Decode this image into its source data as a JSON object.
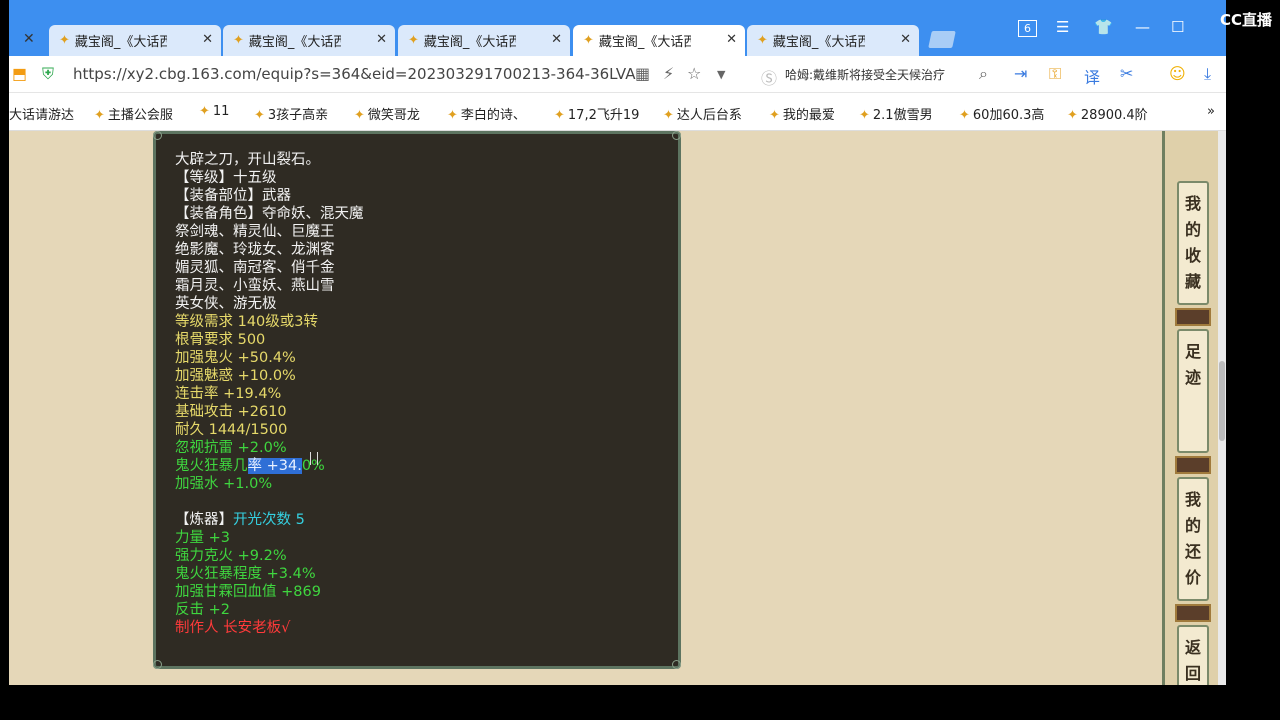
{
  "tabs": [
    {
      "label": "藏宝阁_《大话西游",
      "active": false
    },
    {
      "label": "藏宝阁_《大话西游",
      "active": false
    },
    {
      "label": "藏宝阁_《大话西游",
      "active": false
    },
    {
      "label": "藏宝阁_《大话西游",
      "active": true
    },
    {
      "label": "藏宝阁_《大话西游",
      "active": false
    }
  ],
  "window": {
    "tab_count": "6"
  },
  "address": {
    "url": "https://xy2.cbg.163.com/equip?s=364&eid=202303291700213-364-36LVA",
    "search_text": "哈姆:戴维斯将接受全天候治疗"
  },
  "bookmarks": [
    "大话请游达",
    "主播公会服",
    "11",
    "3孩子高亲",
    "微笑哥龙",
    "李白的诗、",
    "17,2飞升19",
    "达人后台系",
    "我的最爱",
    "2.1傲雪男",
    "60加60.3高",
    "28900.4阶"
  ],
  "item": {
    "lines": [
      {
        "text": "大辟之刀，开山裂石。",
        "color": "white"
      },
      {
        "text": "【等级】十五级",
        "color": "white"
      },
      {
        "text": "【装备部位】武器",
        "color": "white"
      },
      {
        "text": "【装备角色】夺命妖、混天魔",
        "color": "white"
      },
      {
        "text": "祭剑魂、精灵仙、巨魔王",
        "color": "white"
      },
      {
        "text": "绝影魔、玲珑女、龙渊客",
        "color": "white"
      },
      {
        "text": "媚灵狐、南冠客、俏千金",
        "color": "white"
      },
      {
        "text": "霜月灵、小蛮妖、燕山雪",
        "color": "white"
      },
      {
        "text": "英女侠、游无极",
        "color": "white"
      },
      {
        "text": "等级需求 140级或3转",
        "color": "yellow"
      },
      {
        "text": "根骨要求 500",
        "color": "yellow"
      },
      {
        "text": "加强鬼火 +50.4%",
        "color": "yellow"
      },
      {
        "text": "加强魅惑 +10.0%",
        "color": "yellow"
      },
      {
        "text": "连击率 +19.4%",
        "color": "yellow"
      },
      {
        "text": "基础攻击 +2610",
        "color": "yellow"
      },
      {
        "text": "耐久 1444/1500",
        "color": "yellow"
      },
      {
        "text": "忽视抗雷 +2.0%",
        "color": "green"
      },
      {
        "text": "鬼火狂暴几率 +34.0%",
        "color": "green",
        "selected_part": "率 +34."
      },
      {
        "text": "加强水 +1.0%",
        "color": "green"
      },
      {
        "text": "",
        "color": "white"
      },
      {
        "text": "【炼器】开光次数 5",
        "color": "mixed"
      },
      {
        "text": "力量 +3",
        "color": "green"
      },
      {
        "text": "强力克火 +9.2%",
        "color": "green"
      },
      {
        "text": "鬼火狂暴程度 +3.4%",
        "color": "green"
      },
      {
        "text": "加强甘霖回血值 +869",
        "color": "green"
      },
      {
        "text": "反击 +2",
        "color": "green"
      },
      {
        "text": "制作人 长安老板√",
        "color": "red"
      }
    ]
  },
  "sidebar": {
    "buttons": [
      {
        "label": "我的收藏",
        "chars": [
          "我",
          "的",
          "收",
          "藏"
        ]
      },
      {
        "label": "足迹",
        "chars": [
          "足",
          "迹"
        ]
      },
      {
        "label": "我的还价",
        "chars": [
          "我",
          "的",
          "还",
          "价"
        ]
      },
      {
        "label": "返回",
        "chars": [
          "返",
          "回"
        ]
      }
    ]
  },
  "overlay": {
    "logo": "CC直播"
  }
}
